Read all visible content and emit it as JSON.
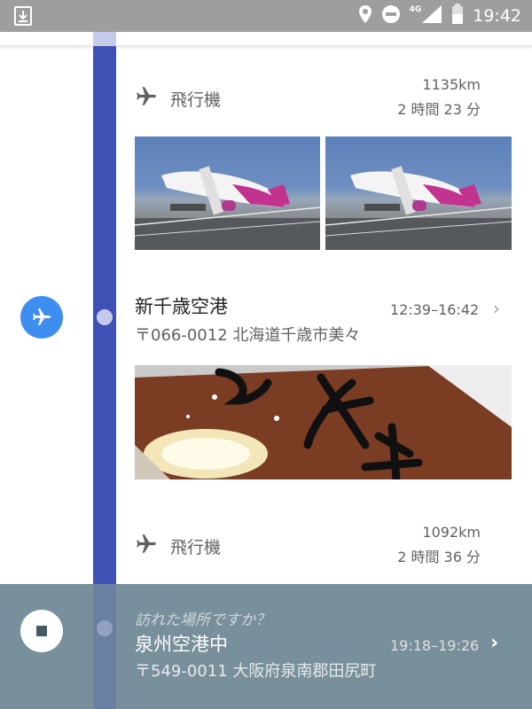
{
  "status_bar": {
    "time": "19:42",
    "network": "4G",
    "icons": [
      "download-icon",
      "location-icon",
      "do-not-disturb-icon",
      "signal-icon",
      "battery-icon"
    ]
  },
  "timeline": {
    "accent_color": "#3f51b5",
    "segments": [
      {
        "mode_label": "飛行機",
        "distance": "1135km",
        "duration": "2 時間 23 分"
      },
      {
        "mode_label": "飛行機",
        "distance": "1092km",
        "duration": "2 時間 36 分"
      }
    ],
    "place": {
      "name": "新千歳空港",
      "address": "〒066-0012 北海道千歳市美々",
      "time_range": "12:39–16:42",
      "icon": "airplane-icon",
      "icon_color": "#3d8ef0"
    }
  },
  "visit_prompt": {
    "question": "訪れた場所ですか？",
    "name": "泉州空港中",
    "time_range": "19:18–19:26",
    "address": "〒549-0011 大阪府泉南郡田尻町",
    "panel_color": "#78909c"
  }
}
